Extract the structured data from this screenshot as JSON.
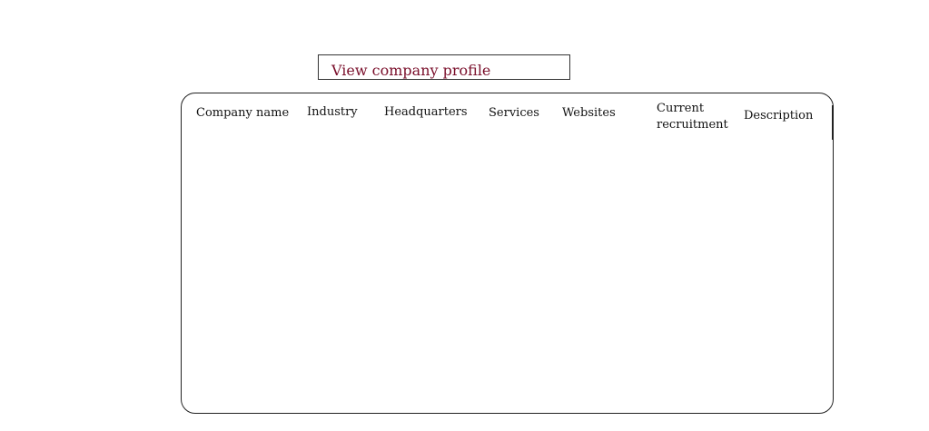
{
  "title": {
    "label": "View company profile",
    "color": "#7a0f2b"
  },
  "table": {
    "columns": [
      "Company name",
      "Industry",
      "Headquarters",
      "Services",
      "Websites",
      "Current recruitment",
      "Description"
    ],
    "rows": []
  }
}
